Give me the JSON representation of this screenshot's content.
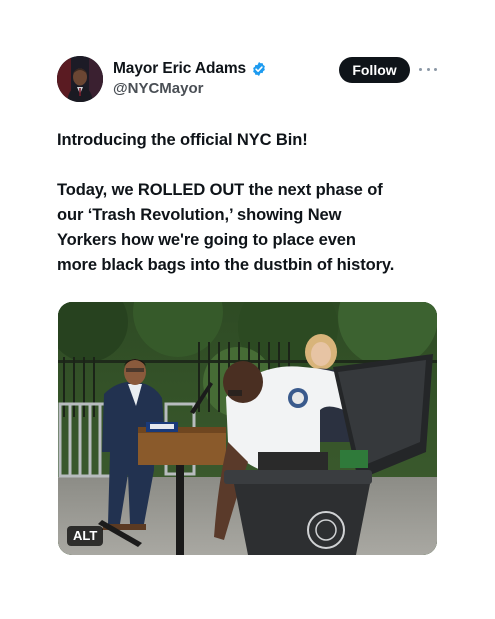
{
  "tweet": {
    "author": {
      "display_name": "Mayor Eric Adams",
      "handle": "@NYCMayor",
      "verified": true,
      "verified_color": "#1d9bf0"
    },
    "follow_label": "Follow",
    "more_icon": "more-horizontal-icon",
    "headline": "Introducing the official NYC Bin!",
    "body": "Today, we ROLLED OUT the next phase of\nour ‘Trash Revolution,’ showing New\nYorkers how we're going to place even\nmore black bags into the dustbin of history.",
    "media": {
      "alt_label": "ALT"
    }
  },
  "colors": {
    "text": "#0f1419",
    "secondary_text": "#4a4f55",
    "follow_bg": "#0f1419",
    "follow_text": "#ffffff"
  }
}
